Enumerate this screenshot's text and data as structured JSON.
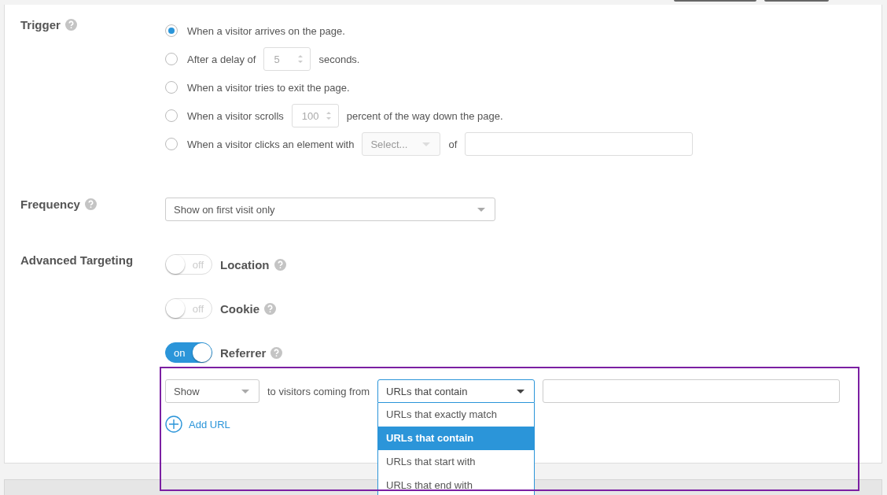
{
  "trigger": {
    "label": "Trigger",
    "options": [
      {
        "kind": "plain",
        "selected": true,
        "text": "When a visitor arrives on the page."
      },
      {
        "kind": "number",
        "selected": false,
        "text": "After a delay of",
        "placeholder": "5",
        "after": "seconds."
      },
      {
        "kind": "plain",
        "selected": false,
        "text": "When a visitor tries to exit the page."
      },
      {
        "kind": "number",
        "selected": false,
        "text": "When a visitor scrolls",
        "placeholder": "100",
        "after": "percent of the way down the page."
      },
      {
        "kind": "element",
        "selected": false,
        "text": "When a visitor clicks an element with",
        "select": "Select...",
        "after": "of"
      }
    ]
  },
  "frequency": {
    "label": "Frequency",
    "value": "Show on first visit only"
  },
  "advanced_targeting": {
    "label": "Advanced Targeting",
    "toggles": [
      {
        "label": "Location",
        "on": false,
        "switch_text": "off"
      },
      {
        "label": "Cookie",
        "on": false,
        "switch_text": "off"
      },
      {
        "label": "Referrer",
        "on": true,
        "switch_text": "on"
      }
    ],
    "referrer_rule": {
      "show_select": "Show",
      "connector": "to visitors coming from",
      "match_select": {
        "value": "URLs that contain",
        "expanded": true,
        "options": [
          {
            "label": "URLs that exactly match",
            "selected": false
          },
          {
            "label": "URLs that contain",
            "selected": true
          },
          {
            "label": "URLs that start with",
            "selected": false
          },
          {
            "label": "URLs that end with",
            "selected": false
          }
        ]
      },
      "add_url": "Add URL"
    }
  }
}
